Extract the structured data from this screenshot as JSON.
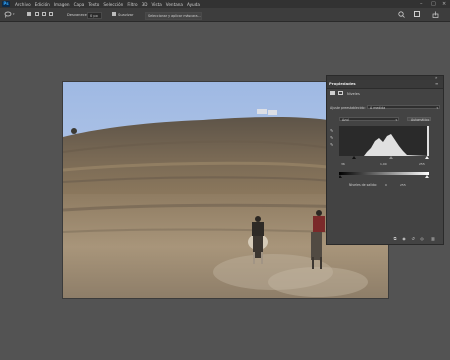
{
  "menu": {
    "logo": "Ps",
    "items": [
      "Archivo",
      "Edición",
      "Imagen",
      "Capa",
      "Texto",
      "Selección",
      "Filtro",
      "3D",
      "Vista",
      "Ventana",
      "Ayuda"
    ]
  },
  "options": {
    "feather_label": "Desvanecer:",
    "feather_value": "0 px",
    "antialias_label": "Suavizar",
    "select_mask_label": "Seleccionar y aplicar máscara..."
  },
  "panel": {
    "title": "Propiedades",
    "layer_type": "Niveles",
    "preset_label": "Ajuste preestablecido:",
    "preset_value": "A medida",
    "channel_value": "Azul",
    "auto_label": "Automático",
    "input_black": "36",
    "input_mid": "1,00",
    "input_white": "255",
    "output_label": "Niveles de salida:",
    "output_black": "0",
    "output_white": "255"
  },
  "colors": {
    "accent": "#31a8ff",
    "menubar": "#323232",
    "panel": "#434343",
    "workspace": "#535353"
  },
  "icons": [
    "photoshop-logo",
    "lasso-icon",
    "new-selection-icon",
    "add-selection-icon",
    "subtract-selection-icon",
    "intersect-selection-icon",
    "search-icon",
    "workspace-icon",
    "share-icon",
    "eyedropper-black-icon",
    "eyedropper-gray-icon",
    "eyedropper-white-icon",
    "clip-layer-icon",
    "view-previous-icon",
    "reset-icon",
    "visibility-icon",
    "trash-icon"
  ]
}
